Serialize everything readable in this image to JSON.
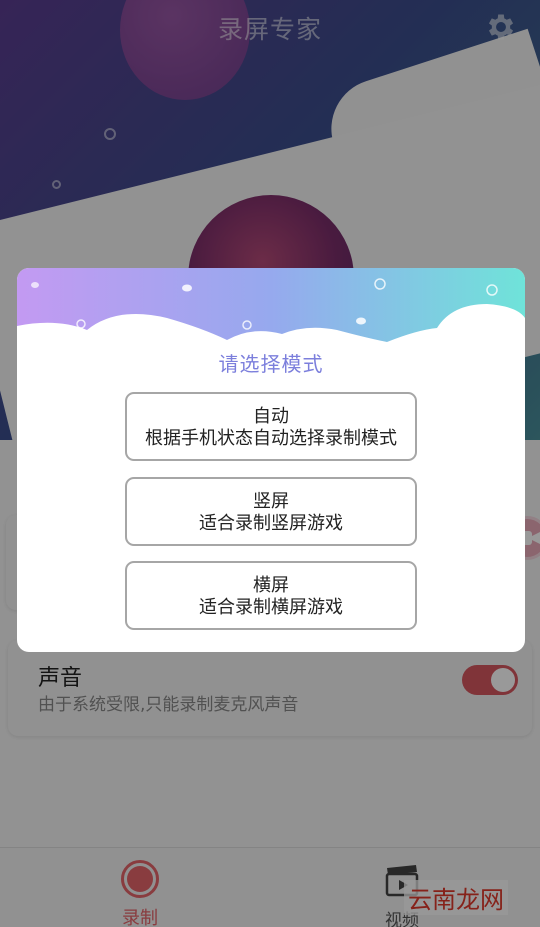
{
  "app": {
    "title": "录屏专家",
    "settings_icon": "gear-icon"
  },
  "sound_setting": {
    "title": "声音",
    "description": "由于系统受限,只能录制麦克风声音",
    "enabled": true,
    "accent_color": "#d5575f"
  },
  "bottom_nav": {
    "record_label": "录制",
    "video_label": "视频",
    "active_color": "#e4646a"
  },
  "dialog": {
    "title": "请选择模式",
    "title_color": "#7c7fdc",
    "options": [
      {
        "name": "自动",
        "description": "根据手机状态自动选择录制模式"
      },
      {
        "name": "竖屏",
        "description": "适合录制竖屏游戏"
      },
      {
        "name": "横屏",
        "description": "适合录制横屏游戏"
      }
    ]
  },
  "watermark": "云南龙网"
}
